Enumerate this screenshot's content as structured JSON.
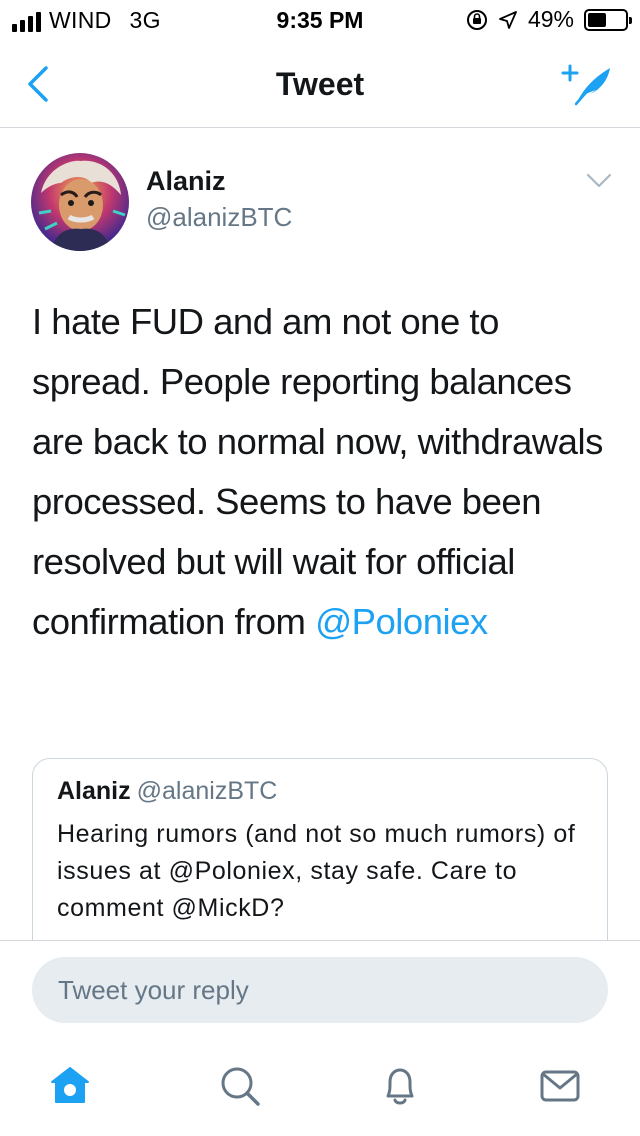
{
  "status_bar": {
    "carrier": "WIND",
    "network": "3G",
    "time": "9:35 PM",
    "battery": "49%",
    "battery_level": 0.49
  },
  "nav": {
    "title": "Tweet"
  },
  "tweet": {
    "author_name": "Alaniz",
    "author_handle": "@alanizBTC",
    "text": "I hate FUD and am not one to spread. People reporting balances are back to normal now, withdrawals processed. Seems to have been resolved but will wait for official confirmation from",
    "mention": "@Poloniex"
  },
  "quoted_tweet": {
    "author_name": "Alaniz",
    "author_handle": "@alanizBTC",
    "text": "Hearing rumors (and not so much rumors) of issues at @Poloniex, stay safe. Care to comment @MickD?"
  },
  "reply": {
    "placeholder": "Tweet your reply"
  },
  "colors": {
    "accent": "#1da1f2",
    "text": "#14171a",
    "muted": "#657786",
    "input_bg": "#e6ecf0"
  },
  "tabs": {
    "items": [
      "home-icon",
      "search-icon",
      "notifications-icon",
      "messages-icon"
    ],
    "active": "home-icon"
  }
}
